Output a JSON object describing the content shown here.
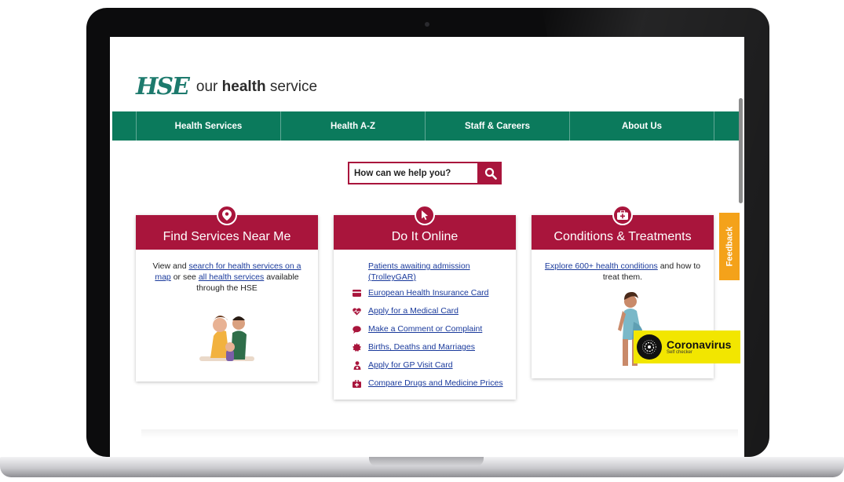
{
  "header": {
    "logo_mark": "HSE",
    "logo_text_prefix": "our ",
    "logo_text_bold": "health",
    "logo_text_suffix": " service"
  },
  "nav": {
    "items": [
      {
        "label": "Health Services"
      },
      {
        "label": "Health A-Z"
      },
      {
        "label": "Staff & Careers"
      },
      {
        "label": "About Us"
      }
    ]
  },
  "search": {
    "placeholder": "How can we help you?",
    "icon": "search-icon"
  },
  "cards": {
    "find": {
      "title": "Find Services Near Me",
      "icon": "location-pin-icon",
      "text_1": "View and ",
      "link_1": "search for health services on a map",
      "text_2": " or see ",
      "link_2": "all health services",
      "text_3": " available through the HSE"
    },
    "online": {
      "title": "Do It Online",
      "icon": "cursor-icon",
      "links": [
        {
          "label": "Patients awaiting admission (TrolleyGAR)",
          "icon": ""
        },
        {
          "label": "European Health Insurance Card",
          "icon": "card-icon"
        },
        {
          "label": "Apply for a Medical Card",
          "icon": "heartbeat-icon"
        },
        {
          "label": "Make a Comment or Complaint",
          "icon": "speech-bubble-icon"
        },
        {
          "label": "Births, Deaths and Marriages",
          "icon": "badge-icon"
        },
        {
          "label": "Apply for GP Visit Card",
          "icon": "doctor-icon"
        },
        {
          "label": "Compare Drugs and Medicine Prices",
          "icon": "medical-kit-icon"
        }
      ]
    },
    "conditions": {
      "title": "Conditions & Treatments",
      "icon": "medical-kit-icon",
      "link": "Explore 600+ health conditions",
      "text": " and how to treat them."
    }
  },
  "feedback": {
    "label": "Feedback"
  },
  "coronavirus": {
    "title": "Coronavirus",
    "subtitle": "Self checker"
  },
  "colors": {
    "brand_green": "#0b7a5c",
    "brand_red": "#a9153c",
    "feedback_orange": "#f4a21a",
    "corona_yellow": "#f2e600"
  }
}
